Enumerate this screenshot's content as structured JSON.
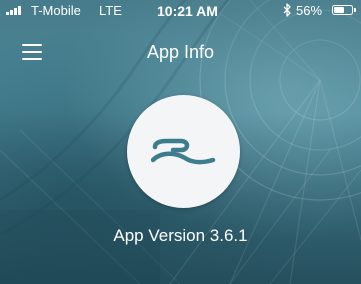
{
  "status_bar": {
    "carrier": "T-Mobile",
    "network": "LTE",
    "time": "10:21 AM",
    "battery_percent": "56%",
    "battery_level": 0.56,
    "bluetooth_icon": "bluetooth-icon",
    "signal_icon": "signal-bars-icon"
  },
  "nav": {
    "title": "App Info",
    "menu_icon": "hamburger-menu-icon"
  },
  "main": {
    "logo_icon": "app-logo-icon",
    "version_text": "App Version 3.6.1"
  },
  "colors": {
    "background_teal": "#4f8fa0",
    "logo_circle": "#f3f5f6",
    "logo_mark": "#3d7d8d",
    "text": "#ffffff"
  }
}
